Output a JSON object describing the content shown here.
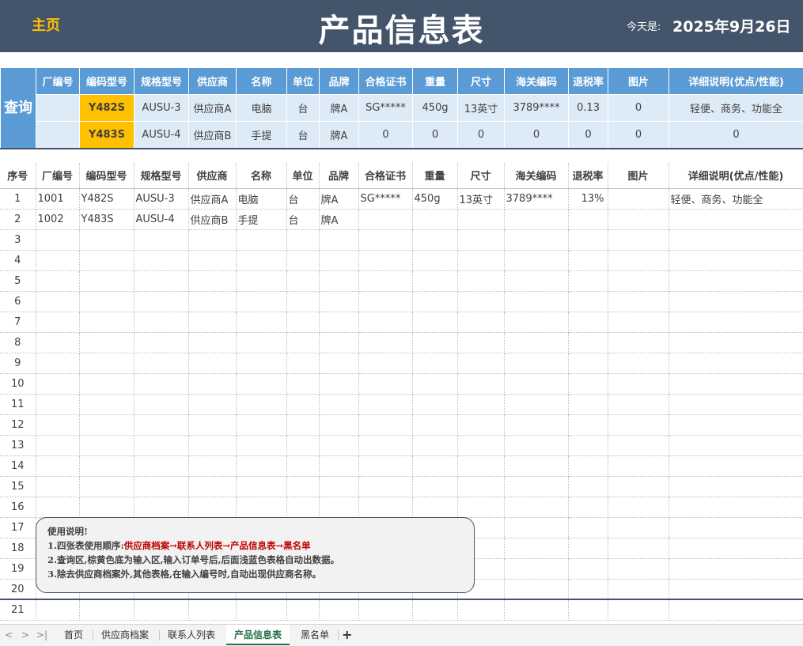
{
  "header": {
    "home": "主页",
    "title": "产品信息表",
    "today_label": "今天是:",
    "today_value": "2025年9月26日"
  },
  "query": {
    "label": "查询",
    "headers": [
      "厂编号",
      "编码型号",
      "规格型号",
      "供应商",
      "名称",
      "单位",
      "品牌",
      "合格证书",
      "重量",
      "尺寸",
      "海关编码",
      "退税率",
      "图片",
      "详细说明(优点/性能)"
    ],
    "rows": [
      [
        "",
        "Y482S",
        "AUSU-3",
        "供应商A",
        "电脑",
        "台",
        "牌A",
        "SG*****",
        "450g",
        "13英寸",
        "3789****",
        "0.13",
        "0",
        "轻便、商务、功能全"
      ],
      [
        "",
        "Y483S",
        "AUSU-4",
        "供应商B",
        "手提",
        "台",
        "牌A",
        "0",
        "0",
        "0",
        "0",
        "0",
        "0",
        "0"
      ]
    ]
  },
  "main": {
    "headers": [
      "序号",
      "厂编号",
      "编码型号",
      "规格型号",
      "供应商",
      "名称",
      "单位",
      "品牌",
      "合格证书",
      "重量",
      "尺寸",
      "海关编码",
      "退税率",
      "图片",
      "详细说明(优点/性能)"
    ],
    "rows": [
      [
        "1",
        "1001",
        "Y482S",
        "AUSU-3",
        "供应商A",
        "电脑",
        "台",
        "牌A",
        "SG*****",
        "450g",
        "13英寸",
        "3789****",
        "13%",
        "",
        "轻便、商务、功能全"
      ],
      [
        "2",
        "1002",
        "Y483S",
        "AUSU-4",
        "供应商B",
        "手提",
        "台",
        "牌A",
        "",
        "",
        "",
        "",
        "",
        "",
        ""
      ],
      [
        "3",
        "",
        "",
        "",
        "",
        "",
        "",
        "",
        "",
        "",
        "",
        "",
        "",
        "",
        ""
      ],
      [
        "4",
        "",
        "",
        "",
        "",
        "",
        "",
        "",
        "",
        "",
        "",
        "",
        "",
        "",
        ""
      ],
      [
        "5",
        "",
        "",
        "",
        "",
        "",
        "",
        "",
        "",
        "",
        "",
        "",
        "",
        "",
        ""
      ],
      [
        "6",
        "",
        "",
        "",
        "",
        "",
        "",
        "",
        "",
        "",
        "",
        "",
        "",
        "",
        ""
      ],
      [
        "7",
        "",
        "",
        "",
        "",
        "",
        "",
        "",
        "",
        "",
        "",
        "",
        "",
        "",
        ""
      ],
      [
        "8",
        "",
        "",
        "",
        "",
        "",
        "",
        "",
        "",
        "",
        "",
        "",
        "",
        "",
        ""
      ],
      [
        "9",
        "",
        "",
        "",
        "",
        "",
        "",
        "",
        "",
        "",
        "",
        "",
        "",
        "",
        ""
      ],
      [
        "10",
        "",
        "",
        "",
        "",
        "",
        "",
        "",
        "",
        "",
        "",
        "",
        "",
        "",
        ""
      ],
      [
        "11",
        "",
        "",
        "",
        "",
        "",
        "",
        "",
        "",
        "",
        "",
        "",
        "",
        "",
        ""
      ],
      [
        "12",
        "",
        "",
        "",
        "",
        "",
        "",
        "",
        "",
        "",
        "",
        "",
        "",
        "",
        ""
      ],
      [
        "13",
        "",
        "",
        "",
        "",
        "",
        "",
        "",
        "",
        "",
        "",
        "",
        "",
        "",
        ""
      ],
      [
        "14",
        "",
        "",
        "",
        "",
        "",
        "",
        "",
        "",
        "",
        "",
        "",
        "",
        "",
        ""
      ],
      [
        "15",
        "",
        "",
        "",
        "",
        "",
        "",
        "",
        "",
        "",
        "",
        "",
        "",
        "",
        ""
      ],
      [
        "16",
        "",
        "",
        "",
        "",
        "",
        "",
        "",
        "",
        "",
        "",
        "",
        "",
        "",
        ""
      ],
      [
        "17",
        "",
        "",
        "",
        "",
        "",
        "",
        "",
        "",
        "",
        "",
        "",
        "",
        "",
        ""
      ],
      [
        "18",
        "",
        "",
        "",
        "",
        "",
        "",
        "",
        "",
        "",
        "",
        "",
        "",
        "",
        ""
      ],
      [
        "19",
        "",
        "",
        "",
        "",
        "",
        "",
        "",
        "",
        "",
        "",
        "",
        "",
        "",
        ""
      ],
      [
        "20",
        "",
        "",
        "",
        "",
        "",
        "",
        "",
        "",
        "",
        "",
        "",
        "",
        "",
        ""
      ],
      [
        "21",
        "",
        "",
        "",
        "",
        "",
        "",
        "",
        "",
        "",
        "",
        "",
        "",
        "",
        ""
      ]
    ]
  },
  "note": {
    "title": "使用说明!",
    "line1_prefix": "1.四张表使用顺序:",
    "line1_order": "供应商档案→联系人列表→产品信息表→黑名单",
    "line2": "2.查询区,棕黄色底为输入区,输入订单号后,后面浅蓝色表格自动出数据。",
    "line3": "3.除去供应商档案外,其他表格,在输入编号时,自动出现供应商名称。"
  },
  "tabs": {
    "nav_prev": "<",
    "nav_next": ">",
    "nav_last": ">|",
    "items": [
      "首页",
      "供应商档案",
      "联系人列表",
      "产品信息表",
      "黑名单"
    ],
    "active": "产品信息表",
    "add": "+"
  },
  "colors": {
    "banner": "#44546a",
    "accent_gold": "#ffc000",
    "query_header": "#5b9bd5",
    "query_row": "#ddebf7",
    "active_tab": "#217346"
  }
}
